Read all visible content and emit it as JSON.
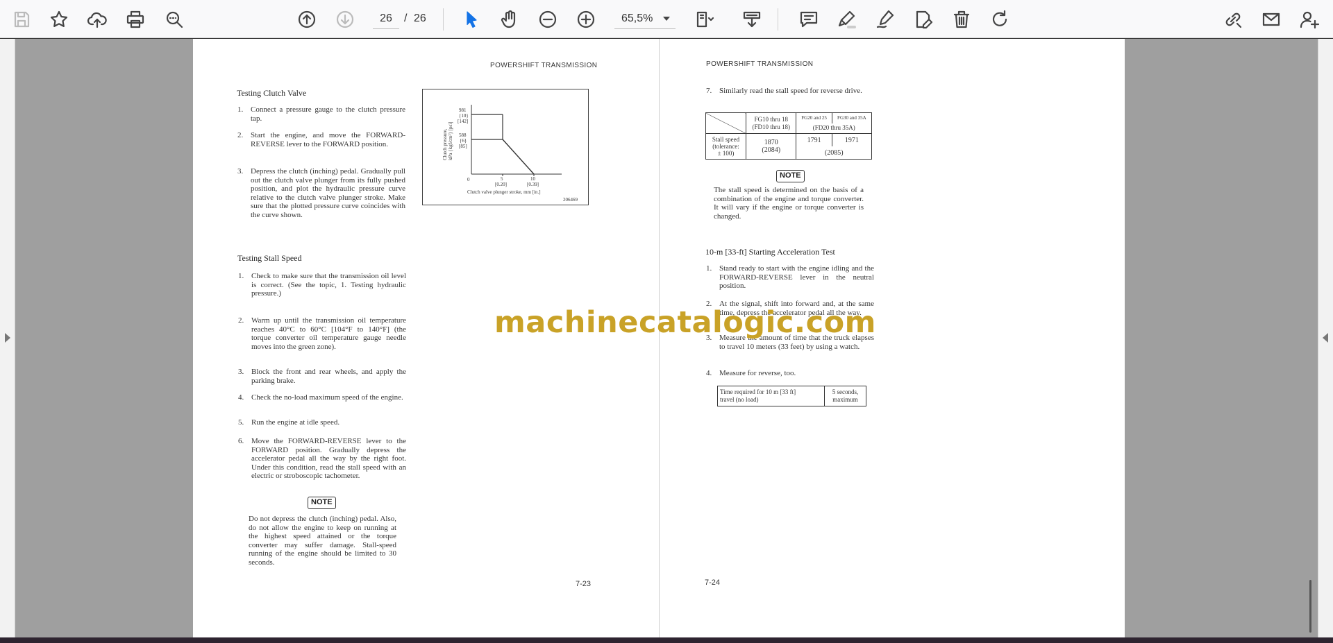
{
  "toolbar": {
    "page_current": "26",
    "page_separator": "/",
    "page_total": "26",
    "zoom": "65,5%",
    "icons": [
      "save-icon",
      "bookmark-star-icon",
      "upload-cloud-icon",
      "print-icon",
      "zoom-search-icon",
      "page-up-icon",
      "page-down-icon",
      "select-cursor-icon",
      "hand-pan-icon",
      "zoom-out-icon",
      "zoom-in-icon",
      "page-fit-icon",
      "scroll-mode-icon",
      "comment-icon",
      "highlight-icon",
      "draw-icon",
      "edit-pdf-icon",
      "delete-icon",
      "rotate-icon",
      "share-link-icon",
      "email-icon",
      "add-user-icon"
    ]
  },
  "document": {
    "left_page": {
      "header": "POWERSHIFT TRANSMISSION",
      "section1_title": "Testing Clutch Valve",
      "section1_steps": [
        {
          "num": "1.",
          "text": "Connect a pressure gauge to the clutch pressure tap."
        },
        {
          "num": "2.",
          "text": "Start the engine, and move the FORWARD-REVERSE lever to the FORWARD position."
        },
        {
          "num": "3.",
          "text": "Depress the clutch (inching) pedal. Gradually pull out the clutch valve plunger from its fully pushed position, and plot the hydraulic pressure curve relative to the clutch valve plunger stroke. Make sure that the plotted pressure curve coincides with the curve shown."
        }
      ],
      "graph": {
        "y_label_line1": "Clutch pressure,",
        "y_label_line2": "kPa {kgf/cm²} [psi]",
        "y_ticks": [
          "981",
          "{10}",
          "[142]",
          "588",
          "{6}",
          "[85]"
        ],
        "x_ticks": [
          "0",
          "5",
          "[0.20]",
          "10",
          "[0.39]"
        ],
        "x_label": "Clutch valve plunger stroke, mm [in.]",
        "figure_id": "206469"
      },
      "section2_title": "Testing Stall Speed",
      "section2_steps": [
        {
          "num": "1.",
          "text": "Check to make sure that the transmission oil level is correct. (See the topic, 1. Testing hydraulic pressure.)"
        },
        {
          "num": "2.",
          "text": "Warm up until the transmission oil temperature reaches 40°C to 60°C [104°F to 140°F] (the torque converter oil temperature gauge needle moves into the green zone)."
        },
        {
          "num": "3.",
          "text": "Block the front and rear wheels, and apply the parking brake."
        },
        {
          "num": "4.",
          "text": "Check the no-load maximum speed of the engine."
        },
        {
          "num": "5.",
          "text": "Run the engine at idle speed."
        },
        {
          "num": "6.",
          "text": "Move the FORWARD-REVERSE lever to the FORWARD position. Gradually depress the accelerator pedal all the way by the right foot. Under this condition, read the stall speed with an electric or stroboscopic tachometer."
        }
      ],
      "note_label": "NOTE",
      "note_text": "Do not depress the clutch (inching) pedal. Also, do not allow the engine to keep on running at the highest speed attained or the torque converter may suffer damage. Stall-speed running of the engine should be limited to 30 seconds.",
      "folio": "7-23"
    },
    "right_page": {
      "header": "POWERSHIFT TRANSMISSION",
      "step7_num": "7.",
      "step7_text": "Similarly read the stall speed for reverse drive.",
      "stall_table": {
        "col1_line1": "FG10 thru 18",
        "col1_line2": "(FD10 thru 18)",
        "col2_line1": "FG20 and 25",
        "col3_line1": "FG30 and 35A",
        "col23_line2": "(FD20 thru 35A)",
        "row_label_line1": "Stall speed",
        "row_label_line2": "(tolerance:",
        "row_label_line3": "± 100)",
        "col1_value": "1870",
        "col1_value2": "(2084)",
        "col2_value": "1791",
        "col3_value": "1971",
        "col23_value2": "(2085)"
      },
      "note_label": "NOTE",
      "note_text": "The stall speed is determined on the basis of a combination of the engine and torque converter. It will vary if the engine or torque converter is changed.",
      "section_title": "10-m [33-ft] Starting Acceleration Test",
      "steps": [
        {
          "num": "1.",
          "text": "Stand ready to start with the engine idling and the FORWARD-REVERSE lever in the neutral position."
        },
        {
          "num": "2.",
          "text": "At the signal, shift into forward and, at the same time, depress the accelerator pedal all the way."
        },
        {
          "num": "3.",
          "text": "Measure the amount of time that the truck elapses to travel 10 meters (33 feet) by using a watch."
        },
        {
          "num": "4.",
          "text": "Measure for reverse, too."
        }
      ],
      "time_table": {
        "label_line1": "Time required for 10 m [33 ft]",
        "label_line2": "travel (no load)",
        "value_line1": "5 seconds,",
        "value_line2": "maximum"
      },
      "folio": "7-24"
    },
    "watermark": "machinecatalogic.com"
  },
  "colors": {
    "viewer_bg": "#9f9f9f",
    "toolbar_bg": "#f9f9fa",
    "accent": "#1473e6",
    "watermark": "#c9a227"
  }
}
